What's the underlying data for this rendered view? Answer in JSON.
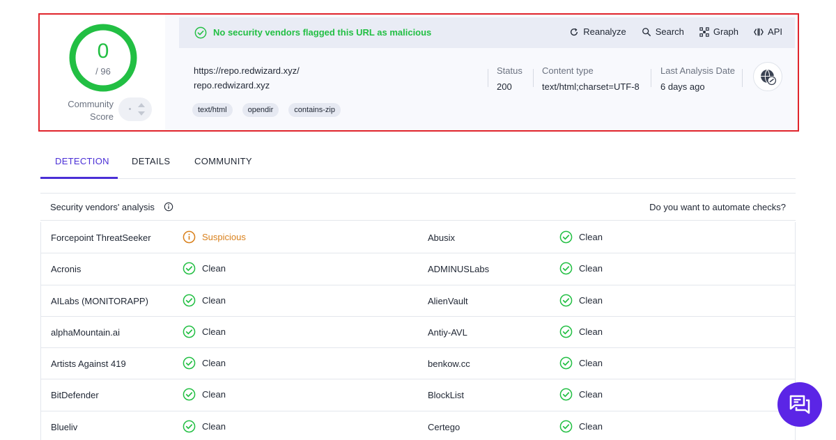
{
  "summary": {
    "score": "0",
    "score_total": "/ 96",
    "community_label_1": "Community",
    "community_label_2": "Score",
    "banner_text": "No security vendors flagged this URL as malicious",
    "actions": [
      {
        "label": "Reanalyze",
        "icon": "refresh-icon"
      },
      {
        "label": "Search",
        "icon": "search-icon"
      },
      {
        "label": "Graph",
        "icon": "graph-icon"
      },
      {
        "label": "API",
        "icon": "api-icon"
      }
    ],
    "url": "https://repo.redwizard.xyz/",
    "host": "repo.redwizard.xyz",
    "tags": [
      "text/html",
      "opendir",
      "contains-zip"
    ],
    "status_label": "Status",
    "status_value": "200",
    "content_type_label": "Content type",
    "content_type_value": "text/html;charset=UTF-8",
    "last_analysis_label": "Last Analysis Date",
    "last_analysis_value": "6 days ago",
    "colors": {
      "clean": "#22bf43",
      "suspicious": "#d9801b",
      "accent": "#4a2fd6",
      "border": "#e0242b"
    }
  },
  "tabs": [
    "DETECTION",
    "DETAILS",
    "COMMUNITY"
  ],
  "vendors": {
    "title": "Security vendors' analysis",
    "automate": "Do you want to automate checks?",
    "rows": [
      [
        {
          "name": "Forcepoint ThreatSeeker",
          "result": "Suspicious"
        },
        {
          "name": "Abusix",
          "result": "Clean"
        }
      ],
      [
        {
          "name": "Acronis",
          "result": "Clean"
        },
        {
          "name": "ADMINUSLabs",
          "result": "Clean"
        }
      ],
      [
        {
          "name": "AILabs (MONITORAPP)",
          "result": "Clean"
        },
        {
          "name": "AlienVault",
          "result": "Clean"
        }
      ],
      [
        {
          "name": "alphaMountain.ai",
          "result": "Clean"
        },
        {
          "name": "Antiy-AVL",
          "result": "Clean"
        }
      ],
      [
        {
          "name": "Artists Against 419",
          "result": "Clean"
        },
        {
          "name": "benkow.cc",
          "result": "Clean"
        }
      ],
      [
        {
          "name": "BitDefender",
          "result": "Clean"
        },
        {
          "name": "BlockList",
          "result": "Clean"
        }
      ],
      [
        {
          "name": "Blueliv",
          "result": "Clean"
        },
        {
          "name": "Certego",
          "result": "Clean"
        }
      ]
    ]
  }
}
